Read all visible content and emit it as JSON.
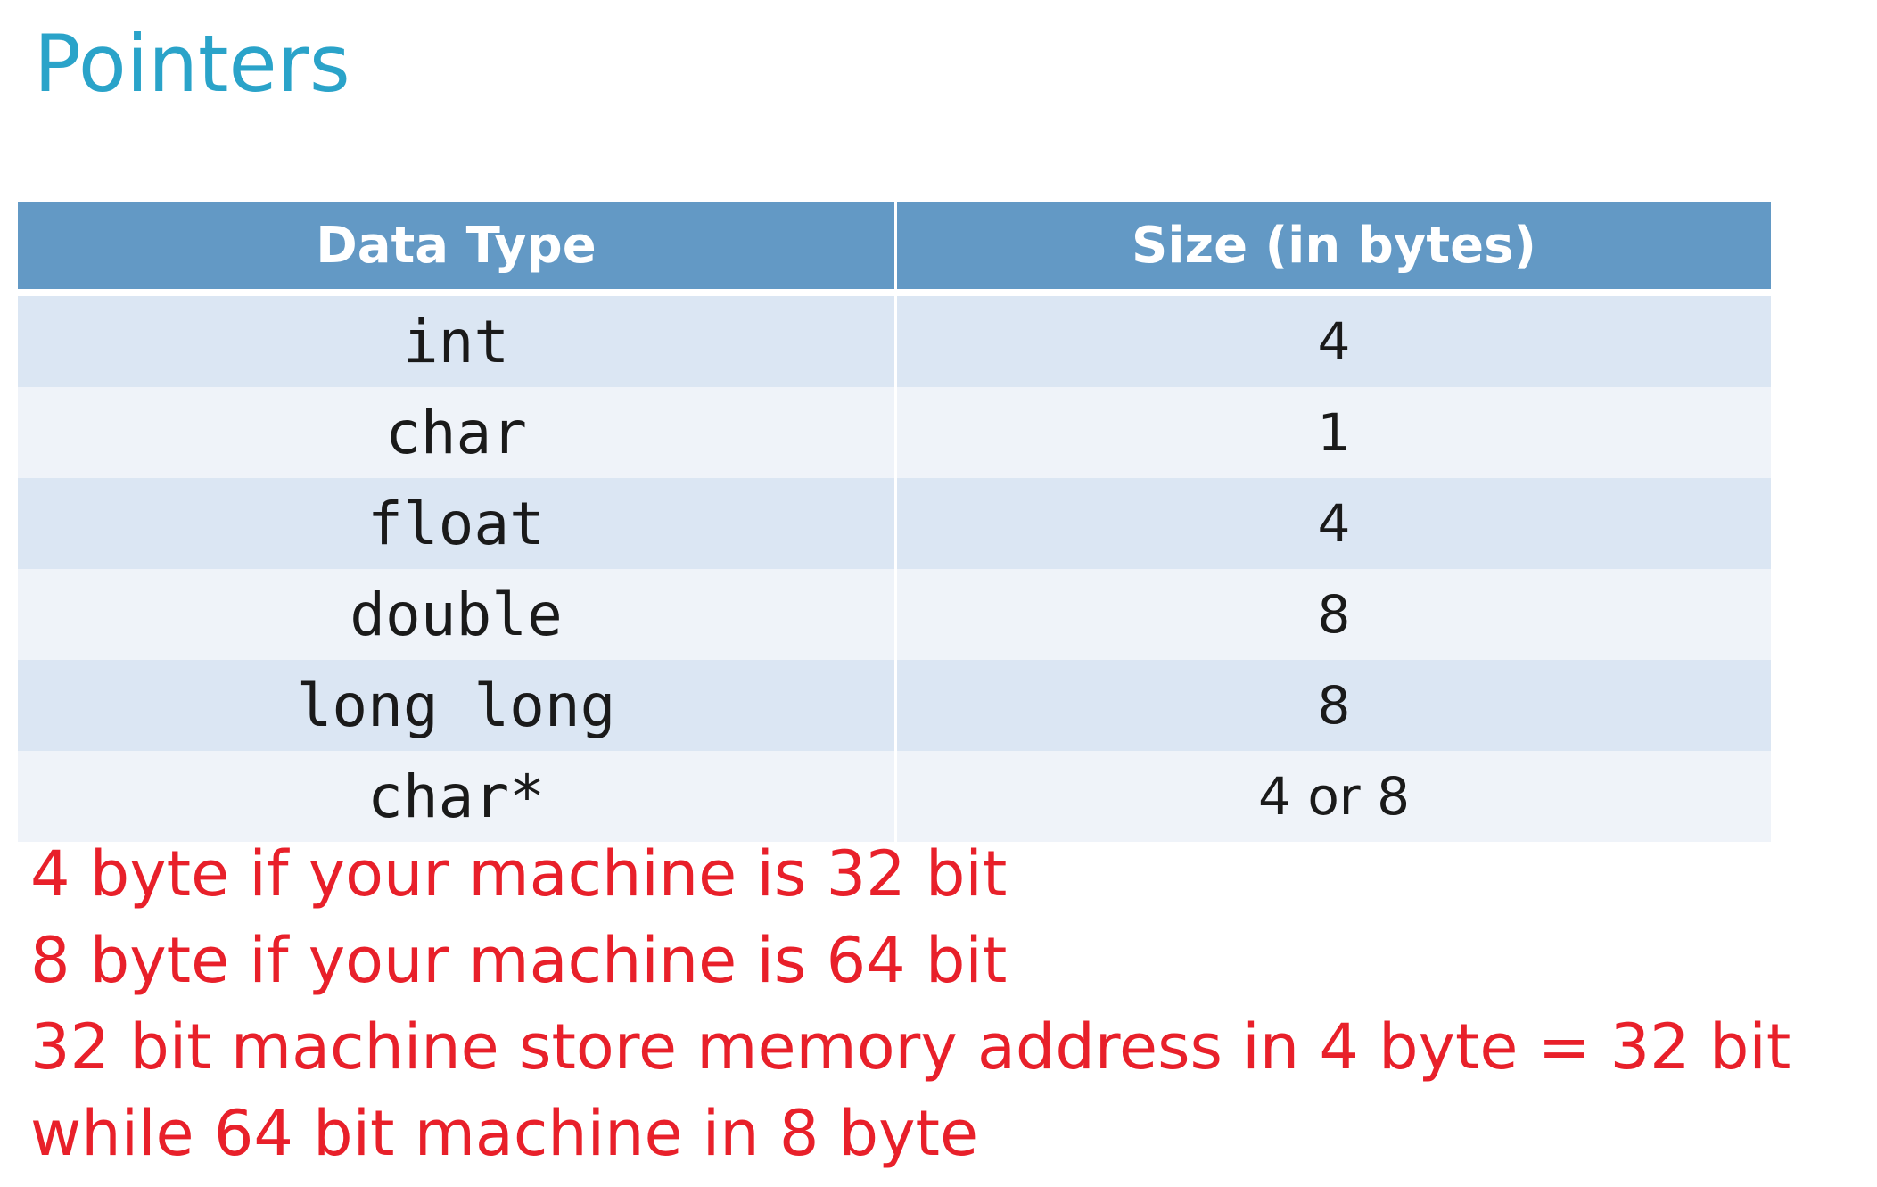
{
  "title": "Pointers",
  "table": {
    "headers": [
      "Data Type",
      "Size (in bytes)"
    ],
    "rows": [
      {
        "type": "int",
        "size": "4"
      },
      {
        "type": "char",
        "size": "1"
      },
      {
        "type": "float",
        "size": "4"
      },
      {
        "type": "double",
        "size": "8"
      },
      {
        "type": "long long",
        "size": "8"
      },
      {
        "type": "char*",
        "size": "4 or 8"
      }
    ]
  },
  "notes": [
    "4 byte if your machine is 32 bit",
    "8 byte if your machine is 64 bit",
    "32 bit machine store memory address in 4 byte = 32 bit",
    "while 64 bit machine in 8 byte"
  ],
  "colors": {
    "title": "#2aa3c9",
    "header_bg": "#6399c5",
    "row_odd": "#dbe6f3",
    "row_even": "#eff3f9",
    "note_text": "#e8202a"
  }
}
